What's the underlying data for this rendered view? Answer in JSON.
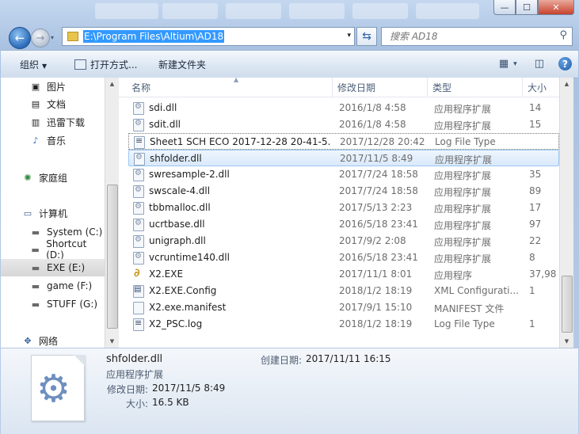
{
  "window": {
    "min_label": "—",
    "max_label": "☐",
    "close_label": "✕"
  },
  "nav": {
    "back_label": "←",
    "forward_label": "→",
    "history_arrow": "▾"
  },
  "address": {
    "path": "E:\\Program Files\\Altium\\AD18",
    "dropdown_arrow": "▾",
    "refresh_label": "⇆"
  },
  "search": {
    "placeholder": "搜索 AD18",
    "icon": "⚲"
  },
  "toolbar": {
    "organize_label": "组织",
    "open_with_label": "打开方式...",
    "new_folder_label": "新建文件夹",
    "view_icon": "▦",
    "view_arrow": "▾",
    "preview_icon": "◫",
    "help_label": "?"
  },
  "sidebar": {
    "items": [
      {
        "label": "图片",
        "icon": "▣"
      },
      {
        "label": "文档",
        "icon": "▤"
      },
      {
        "label": "迅雷下载",
        "icon": "▥"
      },
      {
        "label": "音乐",
        "icon": "♪"
      },
      {
        "label": "家庭组",
        "icon": "✺"
      },
      {
        "label": "计算机",
        "icon": "▭"
      },
      {
        "label": "System (C:)",
        "icon": "▬"
      },
      {
        "label": "Shortcut (D:)",
        "icon": "▬"
      },
      {
        "label": "EXE (E:)",
        "icon": "▬"
      },
      {
        "label": "game (F:)",
        "icon": "▬"
      },
      {
        "label": "STUFF (G:)",
        "icon": "▬"
      },
      {
        "label": "网络",
        "icon": "✥"
      }
    ]
  },
  "columns": {
    "name": "名称",
    "date": "修改日期",
    "type": "类型",
    "size": "大小"
  },
  "files": [
    {
      "name": "sdi.dll",
      "date": "2016/1/8 4:58",
      "type": "应用程序扩展",
      "size": "14",
      "icon": "dll"
    },
    {
      "name": "sdit.dll",
      "date": "2016/1/8 4:58",
      "type": "应用程序扩展",
      "size": "15",
      "icon": "dll"
    },
    {
      "name": "Sheet1 SCH ECO 2017-12-28 20-41-5...",
      "date": "2017/12/28 20:42",
      "type": "Log File Type",
      "size": "",
      "icon": "log"
    },
    {
      "name": "shfolder.dll",
      "date": "2017/11/5 8:49",
      "type": "应用程序扩展",
      "size": "",
      "icon": "dll"
    },
    {
      "name": "swresample-2.dll",
      "date": "2017/7/24 18:58",
      "type": "应用程序扩展",
      "size": "35",
      "icon": "dll"
    },
    {
      "name": "swscale-4.dll",
      "date": "2017/7/24 18:58",
      "type": "应用程序扩展",
      "size": "89",
      "icon": "dll"
    },
    {
      "name": "tbbmalloc.dll",
      "date": "2017/5/13 2:23",
      "type": "应用程序扩展",
      "size": "17",
      "icon": "dll"
    },
    {
      "name": "ucrtbase.dll",
      "date": "2016/5/18 23:41",
      "type": "应用程序扩展",
      "size": "97",
      "icon": "dll"
    },
    {
      "name": "unigraph.dll",
      "date": "2017/9/2 2:08",
      "type": "应用程序扩展",
      "size": "22",
      "icon": "dll"
    },
    {
      "name": "vcruntime140.dll",
      "date": "2016/5/18 23:41",
      "type": "应用程序扩展",
      "size": "8",
      "icon": "dll"
    },
    {
      "name": "X2.EXE",
      "date": "2017/11/1 8:01",
      "type": "应用程序",
      "size": "37,98",
      "icon": "exe"
    },
    {
      "name": "X2.EXE.Config",
      "date": "2018/1/2 18:19",
      "type": "XML Configurati...",
      "size": "1",
      "icon": "xml"
    },
    {
      "name": "X2.exe.manifest",
      "date": "2017/9/1 15:10",
      "type": "MANIFEST 文件",
      "size": "",
      "icon": "plain"
    },
    {
      "name": "X2_PSC.log",
      "date": "2018/1/2 18:19",
      "type": "Log File Type",
      "size": "1",
      "icon": "log"
    }
  ],
  "details": {
    "filename": "shfolder.dll",
    "filetype": "应用程序扩展",
    "modified_label": "修改日期:",
    "modified_value": "2017/11/5 8:49",
    "size_label": "大小:",
    "size_value": "16.5 KB",
    "created_label": "创建日期:",
    "created_value": "2017/11/11 16:15",
    "icon": "⚙"
  }
}
